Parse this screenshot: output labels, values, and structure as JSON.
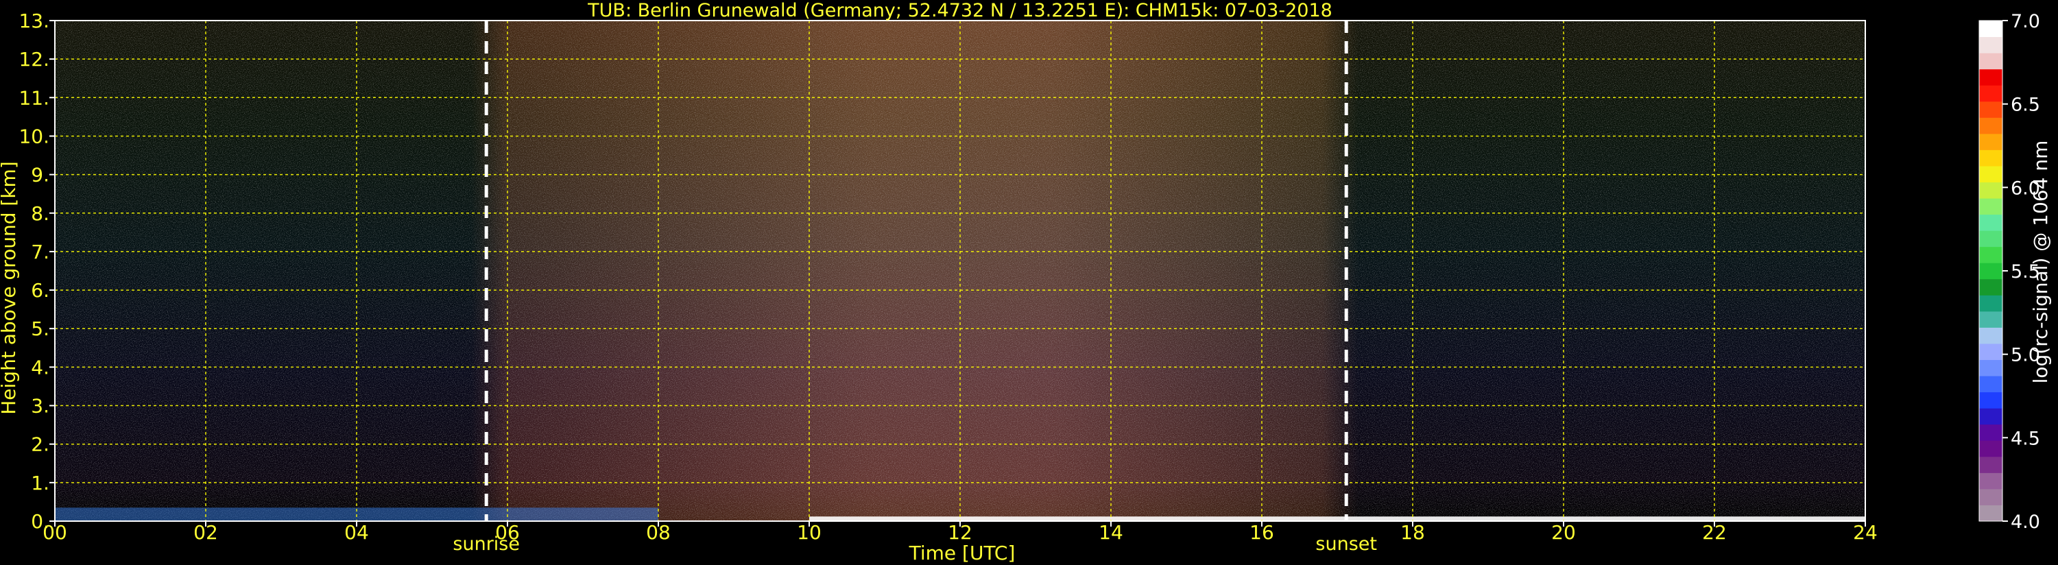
{
  "chart_data": {
    "type": "heatmap",
    "title": "TUB: Berlin Grunewald (Germany; 52.4732 N / 13.2251 E):    CHM15k: 07-03-2018",
    "xlabel": "Time [UTC]",
    "ylabel": "Height above ground [km]",
    "xlim": [
      0,
      24
    ],
    "ylim": [
      0,
      13
    ],
    "x_ticks": [
      "00",
      "02",
      "04",
      "06",
      "08",
      "10",
      "12",
      "14",
      "16",
      "18",
      "20",
      "22",
      "24"
    ],
    "y_ticks": [
      "0.",
      "1.",
      "2.",
      "3.",
      "4.",
      "5.",
      "6.",
      "7.",
      "8.",
      "9.",
      "10.",
      "11.",
      "12.",
      "13."
    ],
    "grid": true,
    "grid_color": "#ffff00",
    "markers": [
      {
        "label": "sunrise",
        "x": 5.72
      },
      {
        "label": "sunset",
        "x": 17.12
      }
    ],
    "colorbar": {
      "label": "log(rc-signal) @ 1064 nm",
      "range": [
        4.0,
        7.0
      ],
      "ticks": [
        "4.0",
        "4.5",
        "5.0",
        "5.5",
        "6.0",
        "6.5",
        "7.0"
      ],
      "colors": [
        "#a996a9",
        "#a07aa0",
        "#97609b",
        "#7d2f8c",
        "#6a0d8c",
        "#5a0aa0",
        "#2a18c8",
        "#1f3fff",
        "#3e68ff",
        "#6f8fff",
        "#9aa9ff",
        "#a8c8f0",
        "#48b8a8",
        "#17a078",
        "#169a2c",
        "#22c43a",
        "#3fd84a",
        "#55e07a",
        "#60e8a0",
        "#8cf06a",
        "#c8f040",
        "#f4f01a",
        "#ffd40a",
        "#ffa60a",
        "#ff7a0a",
        "#ff4a0a",
        "#ff1a0a",
        "#ef0000",
        "#f0c4c4",
        "#f2e2e2",
        "#ffffff"
      ]
    },
    "accent_color": "#ffff33"
  }
}
